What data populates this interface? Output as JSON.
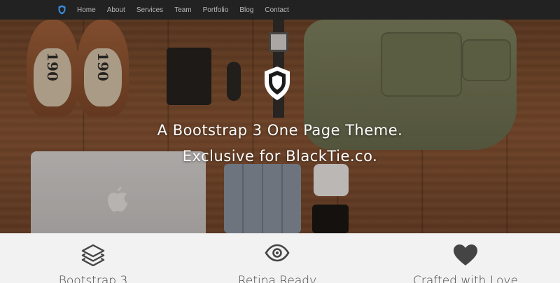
{
  "navbar": {
    "logo_icon": "shield-icon",
    "logo_color": "#3a8ee0",
    "items": [
      {
        "label": "Home"
      },
      {
        "label": "About"
      },
      {
        "label": "Services"
      },
      {
        "label": "Team"
      },
      {
        "label": "Portfolio"
      },
      {
        "label": "Blog"
      },
      {
        "label": "Contact"
      }
    ]
  },
  "hero": {
    "emblem_icon": "shield-icon",
    "line1": "A Bootstrap 3 One Page Theme.",
    "line2": "Exclusive for BlackTie.co.",
    "shoe_label_left": "190",
    "shoe_label_right": "190"
  },
  "features": [
    {
      "icon": "layers-icon",
      "title": "Bootstrap 3"
    },
    {
      "icon": "eye-icon",
      "title": "Retina Ready"
    },
    {
      "icon": "heart-icon",
      "title": "Crafted with Love"
    }
  ]
}
